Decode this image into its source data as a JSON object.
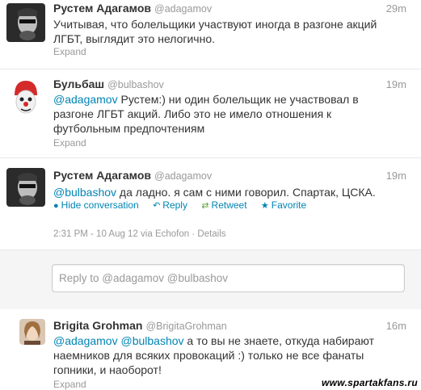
{
  "tweets": [
    {
      "name": "Рустем Адагамов",
      "handle": "@adagamov",
      "time": "29m",
      "text": "Учитывая, что болельщики участвуют иногда в разгоне акций ЛГБТ, выглядит это нелогично.",
      "expand": "Expand"
    },
    {
      "name": "Бульбаш",
      "handle": "@bulbashov",
      "time": "19m",
      "mention": "@adagamov",
      "text": " Рустем:) ни один болельщик не участвовал в разгоне ЛГБТ акций. Либо это не имело отношения к футбольным предпочтениям",
      "expand": "Expand"
    },
    {
      "name": "Рустем Адагамов",
      "handle": "@adagamov",
      "time": "19m",
      "mention": "@bulbashov",
      "text": " да ладно. я сам с ними говорил. Спартак, ЦСКА.",
      "actions": {
        "hide": "Hide conversation",
        "reply": "Reply",
        "retweet": "Retweet",
        "favorite": "Favorite"
      },
      "meta": {
        "timestamp": "2:31 PM - 10 Aug 12",
        "via": " via ",
        "client": "Echofon",
        "separator": " · ",
        "details": "Details"
      }
    },
    {
      "name": "Brigita Grohman",
      "handle": "@BrigitaGrohman",
      "time": "16m",
      "mention1": "@adagamov",
      "mention2": "@bulbashov",
      "text": " а то вы не знаете, откуда набирают наемников для всяких провокаций :) только не все фанаты гопники, и наоборот!",
      "expand": "Expand"
    }
  ],
  "reply_box": {
    "placeholder": "Reply to @adagamov @bulbashov"
  },
  "watermark": "www.spartakfans.ru",
  "colors": {
    "link": "#0084b4",
    "muted": "#999999",
    "text": "#333333"
  }
}
